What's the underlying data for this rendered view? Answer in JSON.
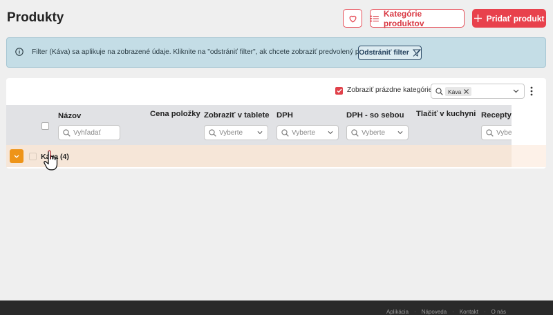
{
  "header": {
    "title": "Produkty",
    "categories_button": "Kategórie produktov",
    "add_button": "Pridať produkt"
  },
  "banner": {
    "text": "Filter (Káva) sa aplikuje na zobrazené údaje. Kliknite na \"odstrániť filter\", ak chcete zobraziť predvolený pohľad.",
    "button": "Odstrániť filter"
  },
  "toolbar": {
    "show_empty_label": "Zobraziť prázdne kategórie",
    "show_empty_checked": true,
    "filter_chip": "Káva"
  },
  "table": {
    "columns": {
      "name": "Názov",
      "price": "Cena položky",
      "show_tablet": "Zobraziť v tablete",
      "vat": "DPH",
      "vat_takeaway": "DPH - so sebou",
      "print_kitchen": "Tlačiť v kuchyni",
      "recipes": "Recepty"
    },
    "filters": {
      "name_placeholder": "Vyhľadať",
      "select_placeholder": "Vyberte",
      "recipes_placeholder": "Vybe"
    },
    "rows": [
      {
        "label": "Káva (4)"
      }
    ]
  },
  "footer": {
    "links": [
      "Aplikácia",
      "Nápoveda",
      "Kontakt",
      "O nás"
    ]
  },
  "colors": {
    "accent": "#e8414c",
    "banner_bg": "#c4dde6",
    "row_highlight": "#f6e6d8",
    "expand_orange": "#ee9418"
  }
}
